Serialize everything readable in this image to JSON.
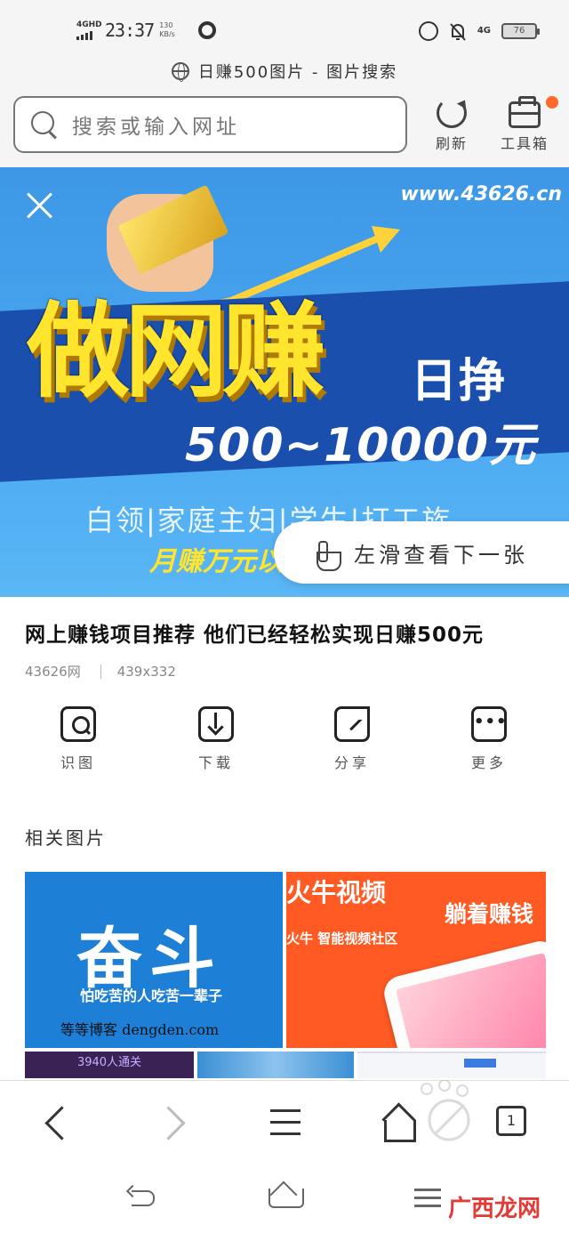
{
  "status_bar": {
    "network": "4GHD",
    "time": "23:37",
    "speed": "130 KB/s",
    "signal_right": "4G",
    "battery": "76"
  },
  "url_bar": {
    "title": "日赚500图片 - 图片搜索"
  },
  "search": {
    "placeholder": "搜索或输入网址",
    "refresh_label": "刷新",
    "toolbox_label": "工具箱"
  },
  "hero": {
    "site": "www.43626.cn",
    "headline": "做网赚",
    "side_text": "日挣",
    "range": "500~10000元",
    "tags": "白领|家庭主妇|学生|打工族",
    "month": "月赚万元以",
    "swipe_hint": "左滑查看下一张"
  },
  "image_info": {
    "title": "网上赚钱项目推荐 他们已经轻松实现日赚500元",
    "source": "43626网",
    "size": "439x332"
  },
  "actions": [
    {
      "label": "识图",
      "icon": "scan-image-icon"
    },
    {
      "label": "下载",
      "icon": "download-icon"
    },
    {
      "label": "分享",
      "icon": "share-icon"
    },
    {
      "label": "更多",
      "icon": "more-icon"
    }
  ],
  "related": {
    "title": "相关图片",
    "thumb1": {
      "big": "奋斗",
      "sub": "怕吃苦的人吃苦一辈子",
      "foot": "等等博客 dengden.com"
    },
    "thumb2": {
      "a": "火牛视频",
      "b": "火牛  智能视频社区",
      "c": "躺着赚钱"
    },
    "thumb3": {
      "text": "3940人通关"
    }
  },
  "bottom_nav": {
    "tabs_count": "1"
  },
  "watermark": "广西龙网"
}
